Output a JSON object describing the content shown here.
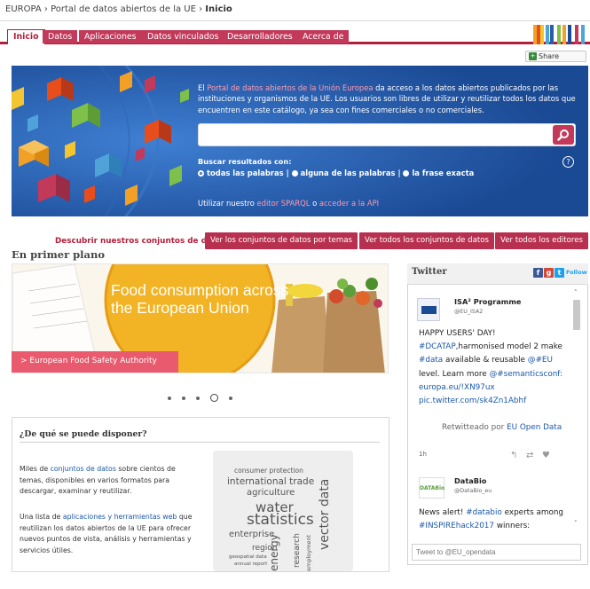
{
  "breadcrumb": {
    "europa": "EUROPA",
    "portal": "Portal de datos abiertos de la UE",
    "current": "Inicio"
  },
  "nav": {
    "tabs": [
      {
        "label": "Inicio",
        "active": true
      },
      {
        "label": "Datos",
        "active": false
      },
      {
        "label": "Aplicaciones",
        "active": false
      },
      {
        "label": "Datos vinculados",
        "active": false
      },
      {
        "label": "Desarrolladores",
        "active": false
      },
      {
        "label": "Acerca de",
        "active": false
      }
    ],
    "brand_colors": [
      "#f3a126",
      "#e84e1b",
      "#4fa3d9",
      "#2b5ea7",
      "#7ec04a",
      "#f3c531",
      "#c2395a",
      "#1b4a94"
    ]
  },
  "share": {
    "label": "Share",
    "icon": "share-plus-icon"
  },
  "hero": {
    "intro_pre": "El ",
    "intro_link": "Portal de datos abiertos de la Unión Europea",
    "intro_post": " da acceso a los datos abiertos publicados por las instituciones y organismos de la UE. Los usuarios son libres de utilizar y reutilizar todos los datos que encuentren en este catálogo, ya sea con fines comerciales o no comerciales.",
    "search_placeholder": "",
    "search_icon": "search-icon",
    "results_label": "Buscar resultados con:",
    "radio_options": [
      "todas las palabras",
      "alguna de las palabras",
      "la frase exacta"
    ],
    "radio_separator": "|",
    "radio_selected": 0,
    "help_symbol": "?",
    "sparql_pre": "Utilizar nuestro ",
    "sparql_link": "editor SPARQL",
    "sparql_mid": " o ",
    "api_link": "acceder a la API",
    "accent": "#c2395a",
    "background": "#1b4a94"
  },
  "discover": {
    "label": "Descubrir nuestros conjuntos de datos",
    "buttons": [
      "Ver los conjuntos de datos por temas",
      "Ver todos los conjuntos de datos",
      "Ver todos los editores"
    ]
  },
  "featured": {
    "title": "En primer plano",
    "slide_title": "Food consumption across the European Union",
    "slide_link": "> European Food Safety Authority",
    "dots_count": 5,
    "active_dot": 3
  },
  "what": {
    "title": "¿De qué se puede disponer?",
    "p1_pre": "Miles de ",
    "p1_link": "conjuntos de datos",
    "p1_post": " sobre cientos de temas, disponibles en varios formatos para descargar, examinar y reutilizar.",
    "p2_pre": "Una lista de ",
    "p2_link": "aplicaciones y herramientas web",
    "p2_post": " que reutilizan los datos abiertos de la UE para ofrecer nuevos puntos de vista, análisis y herramientas y servicios útiles.",
    "cloud": [
      "consumer protection",
      "international trade",
      "agriculture",
      "water",
      "statistics",
      "enterprise",
      "region",
      "geospatial data",
      "annual report",
      "energy",
      "research",
      "employment",
      "vector data"
    ]
  },
  "twitter": {
    "title": "Twitter",
    "follow_label": "Follow",
    "icons": [
      "facebook-icon",
      "google-plus-icon",
      "twitter-bird-icon"
    ],
    "tweets": [
      {
        "name": "ISA² Programme",
        "handle": "@EU_ISA2",
        "text_parts": [
          {
            "t": "HAPPY USERS' DAY! ",
            "h": false
          },
          {
            "t": "#DCATAP",
            "h": true
          },
          {
            "t": ",harmonised model 2 make ",
            "h": false
          },
          {
            "t": "#data",
            "h": true
          },
          {
            "t": " available & reusable ",
            "h": false
          },
          {
            "t": "@#EU",
            "h": true
          },
          {
            "t": " level. Learn more ",
            "h": false
          },
          {
            "t": "@#semanticsconf: europa.eu/!XN97ux pic.twitter.com/sk4Zn1Abhf",
            "h": true
          }
        ],
        "retweet_pre": "Retwitteado por ",
        "retweet_by": "EU Open Data",
        "time": "1h"
      },
      {
        "name": "DataBio",
        "handle": "@DataBio_eu",
        "text_parts": [
          {
            "t": "News alert! ",
            "h": false
          },
          {
            "t": "#databio",
            "h": true
          },
          {
            "t": " experts among ",
            "h": false
          },
          {
            "t": "#INSPIREhack2017",
            "h": true
          },
          {
            "t": " winners:",
            "h": false
          }
        ]
      }
    ],
    "compose_placeholder": "Tweet to @EU_opendata"
  }
}
